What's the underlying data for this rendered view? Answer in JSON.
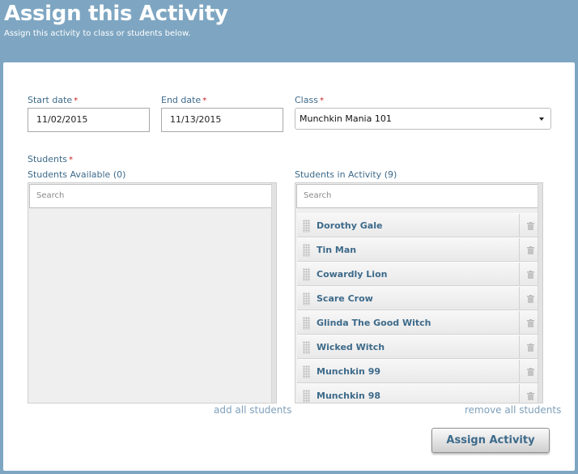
{
  "header": {
    "title": "Assign this Activity",
    "subtitle": "Assign this activity to class or students below."
  },
  "form": {
    "required_mark": "*",
    "start_date": {
      "label": "Start date",
      "value": "11/02/2015"
    },
    "end_date": {
      "label": "End date",
      "value": "11/13/2015"
    },
    "class": {
      "label": "Class",
      "value": "Munchkin Mania 101"
    },
    "students_label": "Students"
  },
  "available": {
    "title": "Students Available (0)",
    "search_placeholder": "Search",
    "action_link": "add all students"
  },
  "in_activity": {
    "title": "Students in Activity (9)",
    "search_placeholder": "Search",
    "action_link": "remove all students",
    "students": [
      "Dorothy Gale",
      "Tin Man",
      "Cowardly Lion",
      "Scare Crow",
      "Glinda The Good Witch",
      "Wicked Witch",
      "Munchkin 99",
      "Munchkin 98"
    ]
  },
  "submit": {
    "label": "Assign Activity"
  },
  "colors": {
    "header_bg": "#7ea6c2",
    "label_blue": "#3d6a8a",
    "link_blue": "#7fa0bb",
    "required_red": "#cc2222"
  },
  "icons": {
    "item_grip": "drag-handle-icon",
    "item_remove": "trash-icon",
    "select_caret": "caret-down-icon"
  }
}
